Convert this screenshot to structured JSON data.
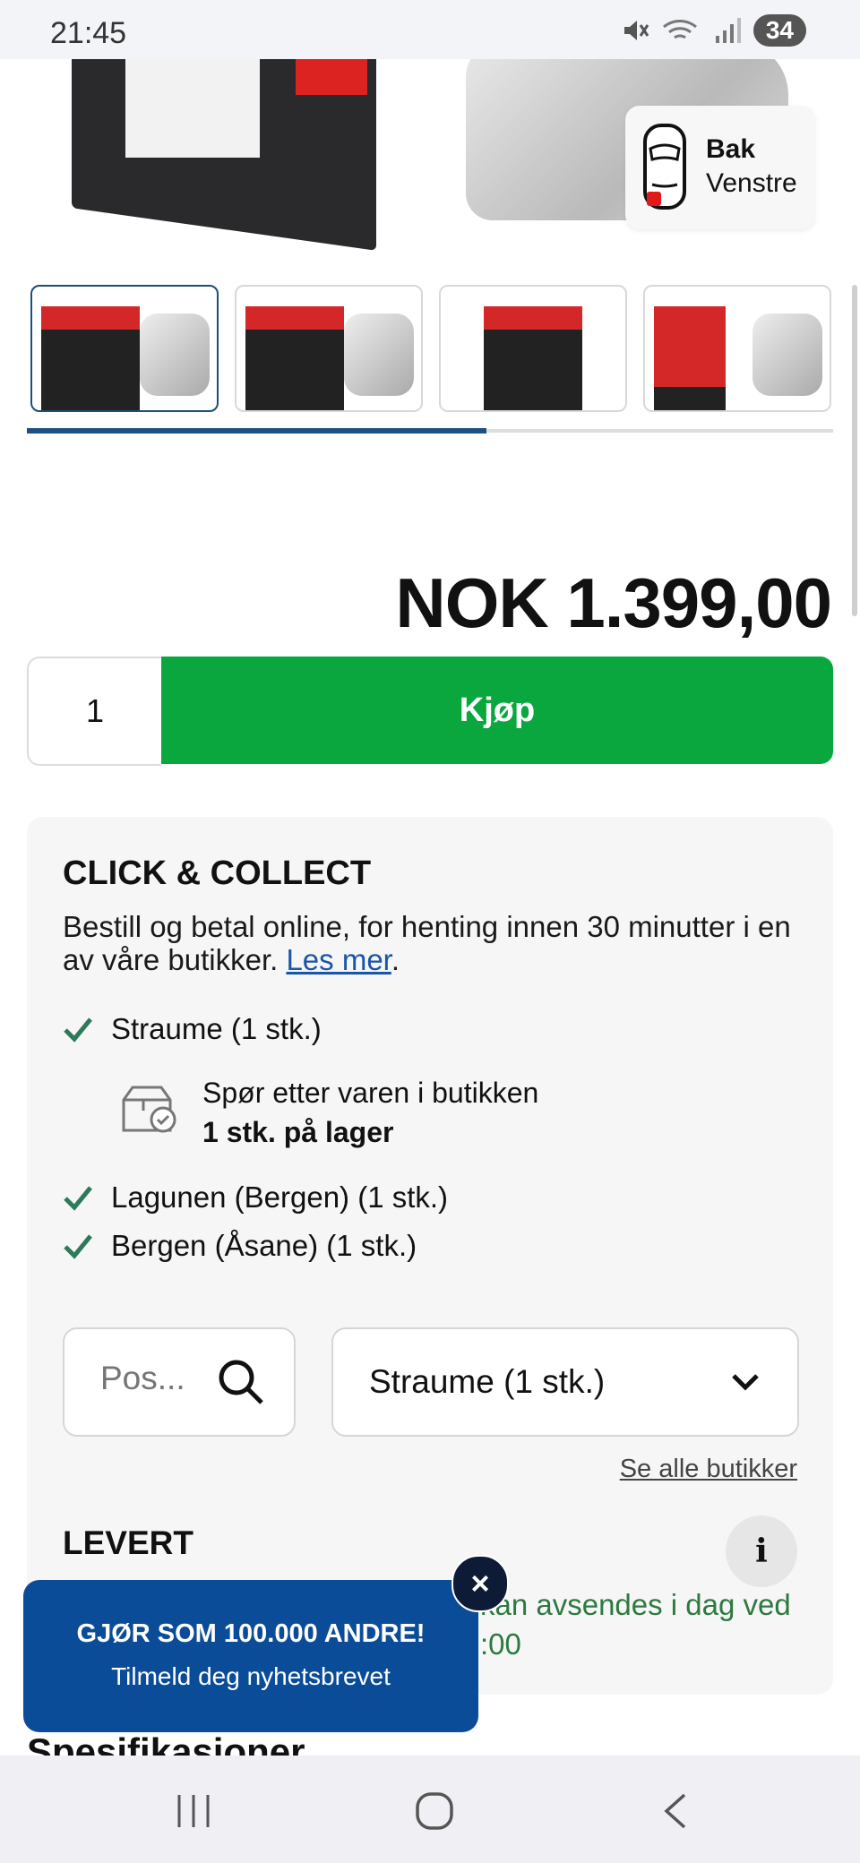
{
  "status_bar": {
    "time": "21:45",
    "battery": "34"
  },
  "product": {
    "position_badge": {
      "line1": "Bak",
      "line2": "Venstre"
    },
    "thumbnail_count": 4,
    "carousel_progress": 0.57,
    "price": "NOK 1.399,00",
    "quantity": "1",
    "buy_label": "Kjøp"
  },
  "click_collect": {
    "title": "CLICK & COLLECT",
    "description": "Bestill og betal online, for henting innen 30 minutter i en av våre butikker.",
    "read_more": "Les mer",
    "stores": [
      {
        "name": "Straume (1 stk.)"
      },
      {
        "name": "Lagunen (Bergen) (1 stk.)"
      },
      {
        "name": "Bergen (Åsane) (1 stk.)"
      }
    ],
    "pickup_note": "Spør etter varen i butikken",
    "stock_note": "1 stk. på lager",
    "postal_placeholder": "Pos...",
    "selected_store": "Straume (1 stk.)",
    "see_all_stores": "Se alle butikker"
  },
  "delivery": {
    "title": "LEVERT",
    "info_icon": "i",
    "shipping_line1": "kan avsendes i dag ved",
    "shipping_line2": ":00"
  },
  "specs_title": "Spesifikasjoner",
  "newsletter": {
    "title": "GJØR SOM 100.000 ANDRE!",
    "subtitle": "Tilmeld deg nyhetsbrevet",
    "close": "×"
  },
  "colors": {
    "buy_green": "#0aa73e",
    "newsletter_blue": "#0b4c98",
    "link_blue": "#1a56a8",
    "check_green": "#2c7a5a"
  }
}
